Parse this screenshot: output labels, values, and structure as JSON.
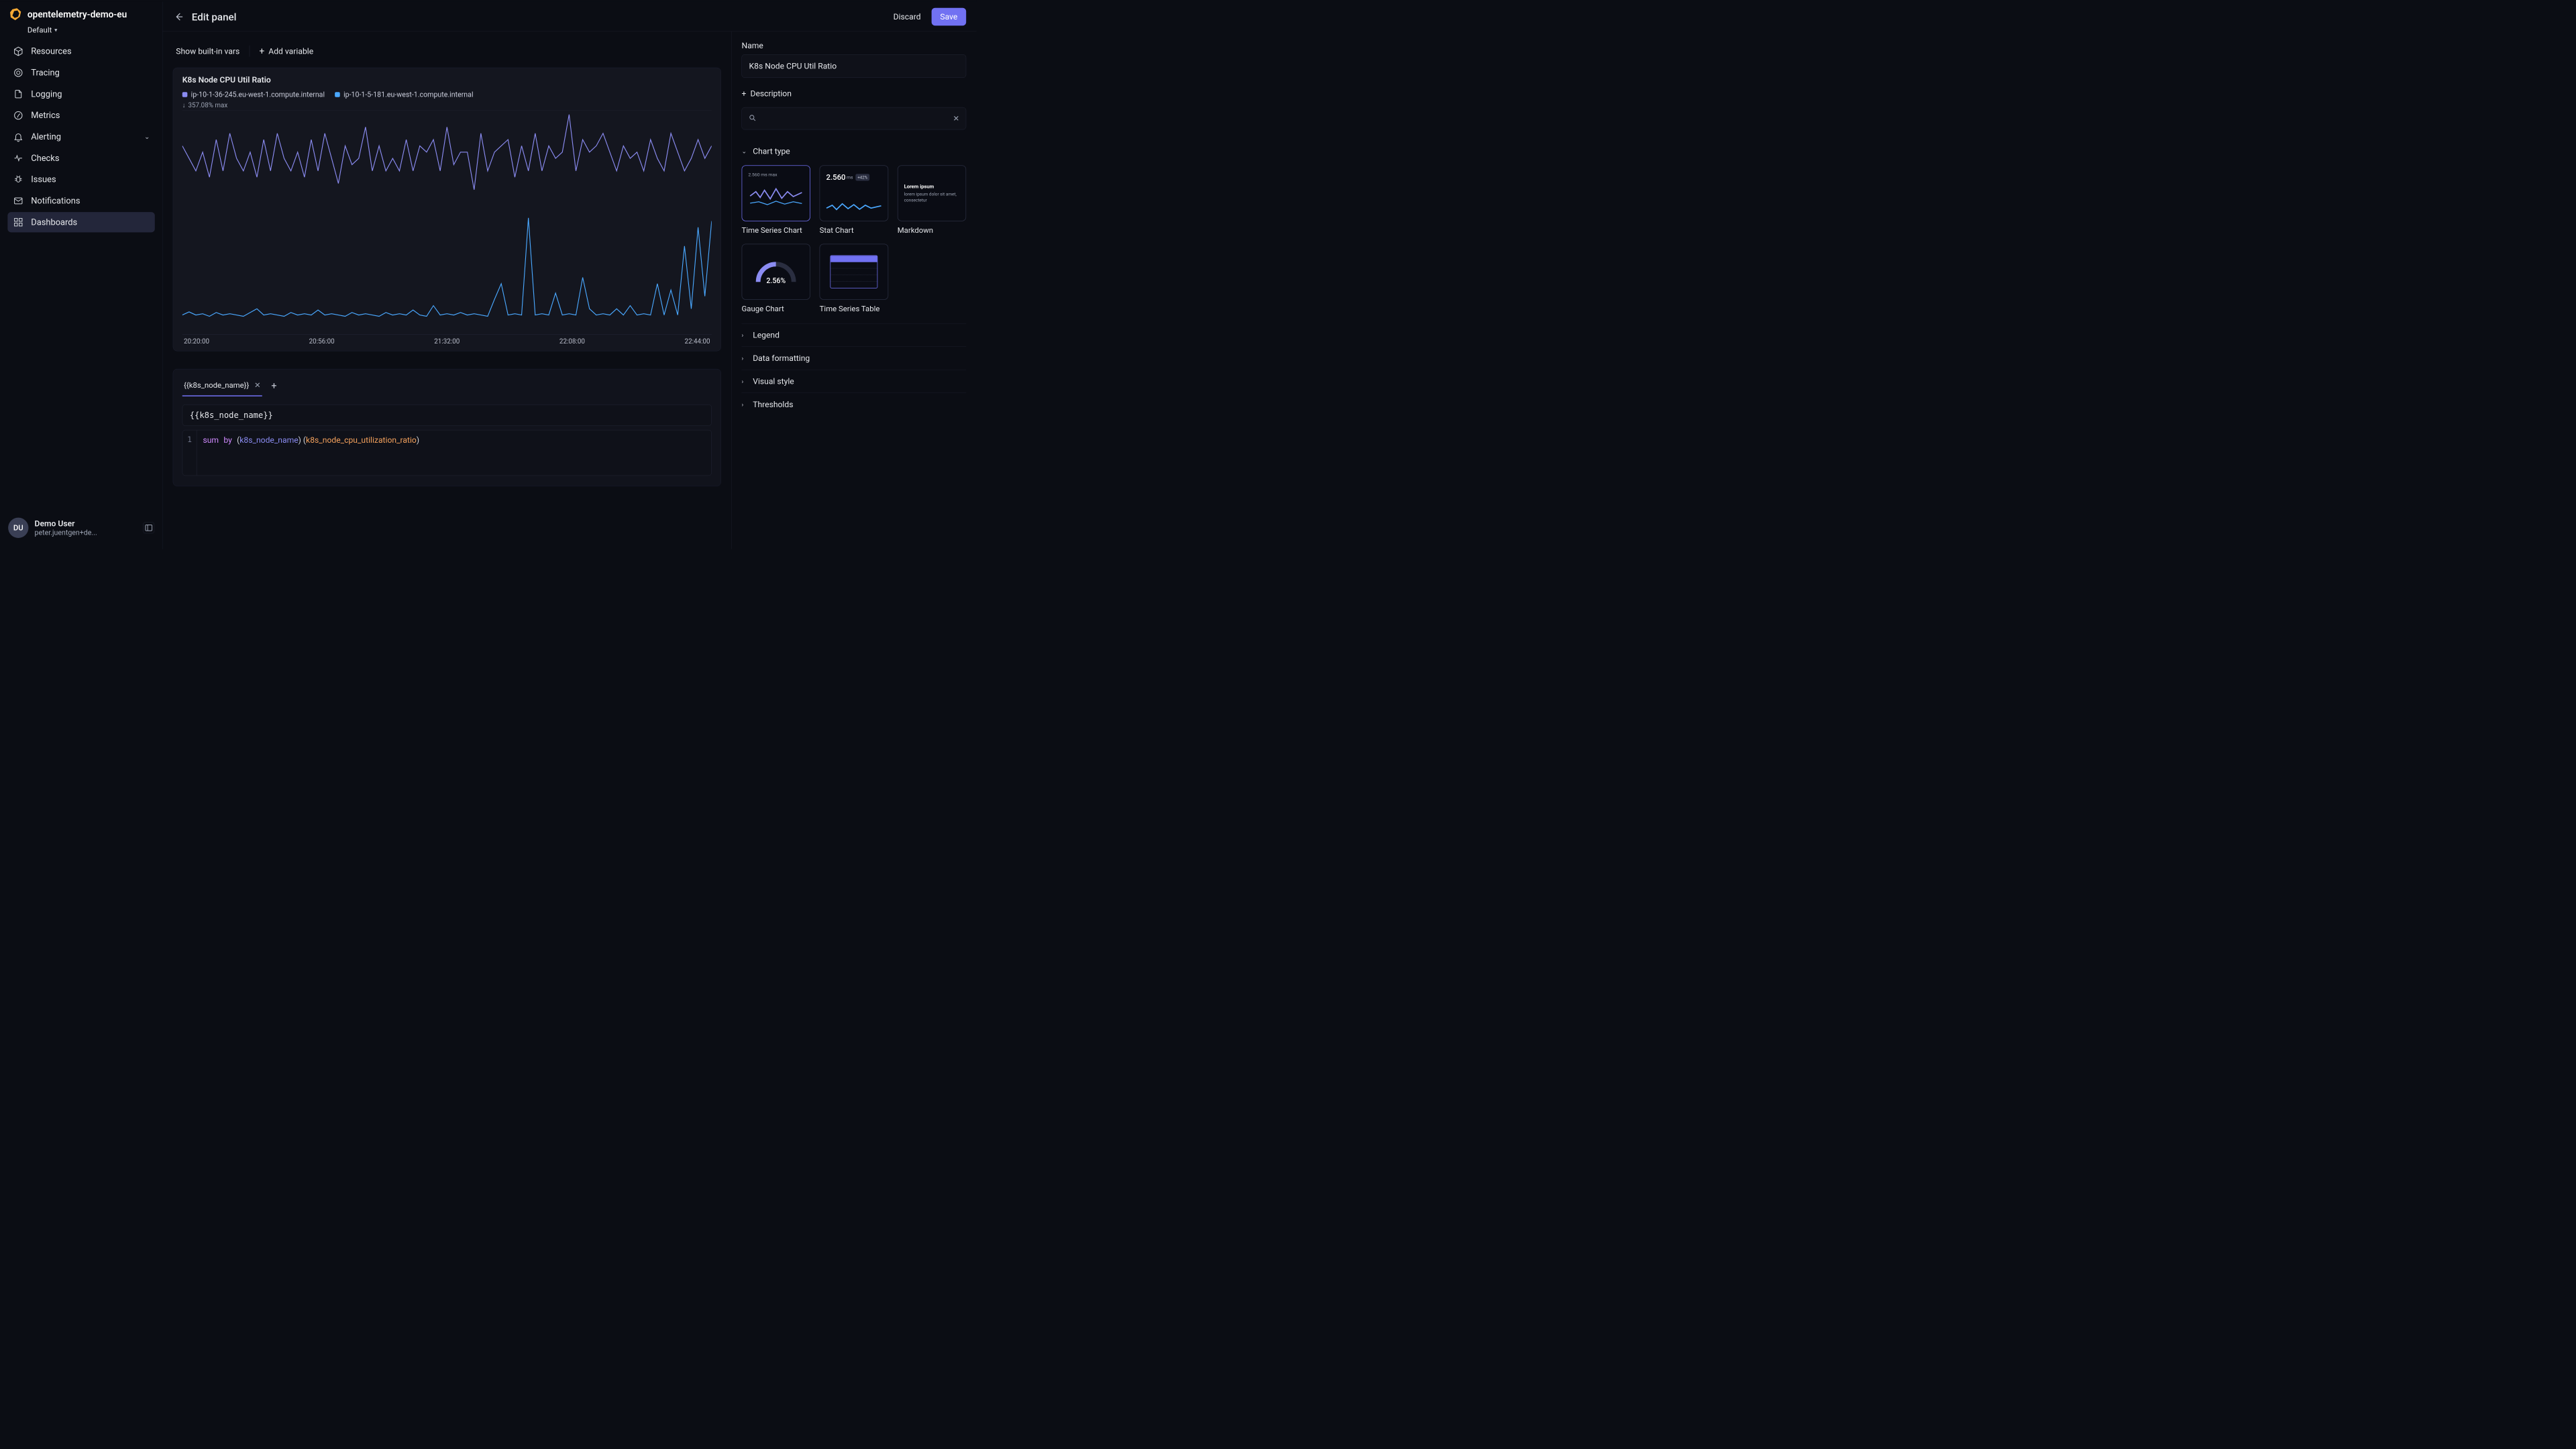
{
  "workspace": {
    "name": "opentelemetry-demo-eu",
    "env": "Default"
  },
  "sidebar": {
    "items": [
      {
        "icon": "box-icon",
        "label": "Resources",
        "expandable": false
      },
      {
        "icon": "tracing-icon",
        "label": "Tracing",
        "expandable": false
      },
      {
        "icon": "logging-icon",
        "label": "Logging",
        "expandable": false
      },
      {
        "icon": "metrics-icon",
        "label": "Metrics",
        "expandable": false
      },
      {
        "icon": "bell-icon",
        "label": "Alerting",
        "expandable": true
      },
      {
        "icon": "heartbeat-icon",
        "label": "Checks",
        "expandable": false
      },
      {
        "icon": "bug-icon",
        "label": "Issues",
        "expandable": false
      },
      {
        "icon": "mail-icon",
        "label": "Notifications",
        "expandable": false
      },
      {
        "icon": "grid-icon",
        "label": "Dashboards",
        "expandable": false,
        "active": true
      }
    ]
  },
  "user": {
    "initials": "DU",
    "name": "Demo User",
    "email": "peter.juentgen+de..."
  },
  "header": {
    "title": "Edit panel",
    "discard": "Discard",
    "save": "Save"
  },
  "center_toolbar": {
    "show_vars": "Show built-in vars",
    "add_variable": "Add variable"
  },
  "panel": {
    "title": "K8s Node CPU Util Ratio",
    "legend": [
      {
        "color": "purple",
        "label": "ip-10-1-36-245.eu-west-1.compute.internal"
      },
      {
        "color": "blue",
        "label": "ip-10-1-5-181.eu-west-1.compute.internal"
      }
    ],
    "max_label": "357.08% max",
    "x_ticks": [
      "20:20:00",
      "20:56:00",
      "21:32:00",
      "22:08:00",
      "22:44:00"
    ]
  },
  "chart_data": {
    "type": "line",
    "title": "K8s Node CPU Util Ratio",
    "xlabel": "",
    "ylabel": "",
    "ylim": [
      0,
      357.08
    ],
    "categories": [
      "20:20:00",
      "20:56:00",
      "21:32:00",
      "22:08:00",
      "22:44:00"
    ],
    "series": [
      {
        "name": "ip-10-1-36-245.eu-west-1.compute.internal",
        "color": "#8b8cf2",
        "values": [
          300,
          280,
          260,
          290,
          250,
          310,
          260,
          320,
          280,
          260,
          290,
          250,
          310,
          260,
          320,
          280,
          260,
          290,
          250,
          310,
          260,
          320,
          280,
          240,
          300,
          270,
          280,
          330,
          260,
          300,
          260,
          280,
          260,
          310,
          260,
          300,
          290,
          310,
          260,
          330,
          270,
          290,
          290,
          230,
          320,
          260,
          290,
          300,
          310,
          250,
          300,
          260,
          320,
          260,
          300,
          280,
          290,
          350,
          260,
          310,
          290,
          300,
          320,
          290,
          260,
          300,
          280,
          290,
          260,
          310,
          280,
          260,
          320,
          290,
          260,
          280,
          310,
          280,
          300
        ]
      },
      {
        "name": "ip-10-1-5-181.eu-west-1.compute.internal",
        "color": "#4aa8ff",
        "values": [
          30,
          35,
          30,
          32,
          28,
          34,
          30,
          32,
          30,
          28,
          34,
          40,
          30,
          32,
          30,
          28,
          34,
          30,
          32,
          30,
          38,
          30,
          32,
          30,
          28,
          34,
          30,
          32,
          30,
          28,
          34,
          30,
          32,
          30,
          38,
          30,
          28,
          45,
          30,
          32,
          30,
          34,
          30,
          32,
          30,
          28,
          55,
          80,
          30,
          32,
          30,
          185,
          30,
          32,
          30,
          65,
          30,
          32,
          30,
          90,
          40,
          30,
          32,
          30,
          40,
          30,
          45,
          30,
          32,
          30,
          80,
          30,
          70,
          30,
          140,
          40,
          170,
          60,
          180
        ]
      }
    ]
  },
  "query": {
    "tab_label": "{{k8s_node_name}}",
    "name_input": "{{k8s_node_name}}",
    "code": {
      "line_no": "1",
      "kw_sum": "sum",
      "kw_by": "by",
      "group": "k8s_node_name",
      "metric": "k8s_node_cpu_utilization_ratio"
    }
  },
  "right": {
    "name_label": "Name",
    "name_value": "K8s Node CPU Util Ratio",
    "description_label": "Description",
    "sections": {
      "chart_type": "Chart type",
      "legend": "Legend",
      "data_formatting": "Data formatting",
      "visual_style": "Visual style",
      "thresholds": "Thresholds"
    },
    "chart_types": [
      {
        "label": "Time Series Chart",
        "selected": true
      },
      {
        "label": "Stat Chart"
      },
      {
        "label": "Markdown"
      },
      {
        "label": "Gauge Chart"
      },
      {
        "label": "Time Series Table"
      }
    ],
    "thumb": {
      "ts_max": "2.560 ms max",
      "stat_val": "2.560",
      "stat_unit": "ms",
      "stat_badge": "+42%",
      "md_title": "Lorem ipsum",
      "md_body": "lorem ipsum dolor sit amet, consectetur",
      "gauge_val": "2.56%"
    }
  }
}
